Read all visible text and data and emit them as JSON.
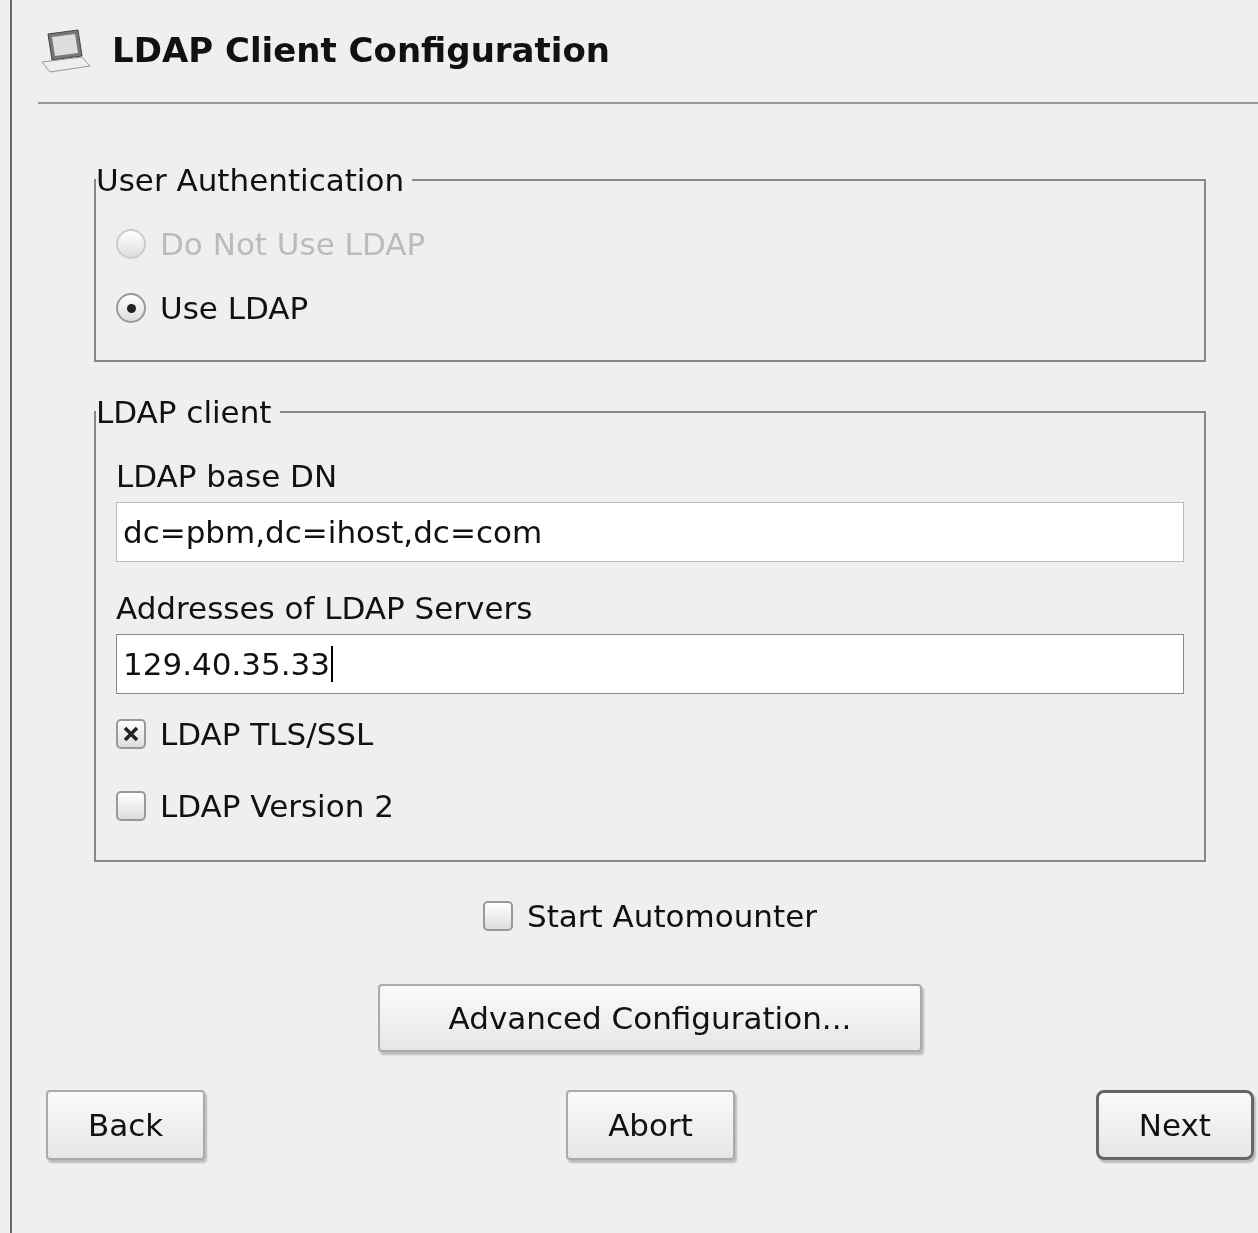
{
  "window": {
    "title": "LDAP Client Configuration"
  },
  "user_authentication": {
    "title": "User Authentication",
    "options": [
      {
        "label": "Do Not Use LDAP",
        "selected": false,
        "disabled": true
      },
      {
        "label": "Use LDAP",
        "selected": true,
        "disabled": false
      }
    ]
  },
  "ldap_client": {
    "title": "LDAP client",
    "fields": [
      {
        "label": "LDAP base DN",
        "value": "dc=pbm,dc=ihost,dc=com",
        "focused": false
      },
      {
        "label": "Addresses of LDAP Servers",
        "value": "129.40.35.33",
        "focused": true
      }
    ],
    "checkboxes": [
      {
        "label": "LDAP TLS/SSL",
        "checked": true
      },
      {
        "label": "LDAP Version 2",
        "checked": false
      }
    ]
  },
  "automounter": {
    "label": "Start Automounter",
    "checked": false
  },
  "advanced_button": {
    "label": "Advanced Configuration..."
  },
  "buttons": [
    {
      "label": "Back",
      "focused": false
    },
    {
      "label": "Abort",
      "focused": false
    },
    {
      "label": "Next",
      "focused": true
    }
  ]
}
